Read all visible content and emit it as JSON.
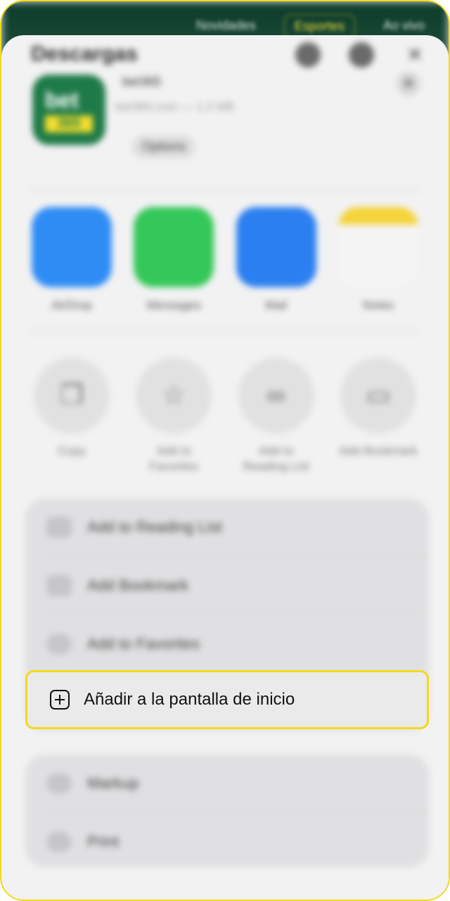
{
  "background_tabs": [
    "Novidades",
    "Esportes",
    "Ao vivo"
  ],
  "sheet": {
    "title": "Descargas",
    "app_name": "bet365",
    "app_url": "bet365.com — 1.2 MB",
    "options_label": "Options",
    "app_icon_text_top": "bet",
    "app_icon_text_bottom": "365"
  },
  "share_targets": [
    {
      "label": "AirDrop",
      "color": "#2f8cf5"
    },
    {
      "label": "Messages",
      "color": "#34c759"
    },
    {
      "label": "Mail",
      "color": "#2c7ff0"
    },
    {
      "label": "Notes",
      "color": "#f2f2f2"
    }
  ],
  "actions": [
    {
      "label": "Copy",
      "icon": "copy-icon",
      "glyph": "❐"
    },
    {
      "label": "Add to Favorites",
      "icon": "star-icon",
      "glyph": "☆"
    },
    {
      "label": "Add to Reading List",
      "icon": "glasses-icon",
      "glyph": "∞"
    },
    {
      "label": "Add Bookmark",
      "icon": "book-icon",
      "glyph": "▭"
    }
  ],
  "menu_group_1": [
    {
      "label": "Add to Reading List"
    },
    {
      "label": "Add Bookmark"
    },
    {
      "label": "Add to Favorites"
    }
  ],
  "highlighted_item": {
    "label": "Añadir a la pantalla de inicio"
  },
  "menu_group_2": [
    {
      "label": "Markup"
    },
    {
      "label": "Print"
    }
  ],
  "colors": {
    "highlight_border": "#f2d91f"
  }
}
